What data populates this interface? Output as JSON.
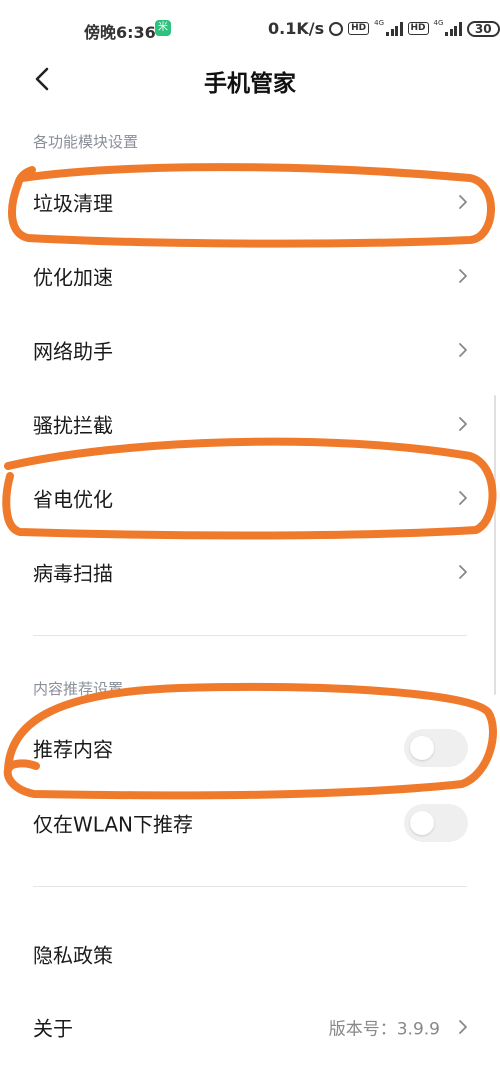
{
  "status_bar": {
    "time": "傍晚6:36",
    "msg_icon": "米",
    "speed": "0.1K/s",
    "hd1": "HD",
    "hd2": "HD",
    "net1": "4G",
    "net2": "4G",
    "battery": "30"
  },
  "header": {
    "title": "手机管家"
  },
  "section1": {
    "label": "各功能模块设置"
  },
  "rows": [
    {
      "label": "垃圾清理"
    },
    {
      "label": "优化加速"
    },
    {
      "label": "网络助手"
    },
    {
      "label": "骚扰拦截"
    },
    {
      "label": "省电优化"
    },
    {
      "label": "病毒扫描"
    }
  ],
  "section2": {
    "label": "内容推荐设置"
  },
  "toggles": [
    {
      "label": "推荐内容",
      "enabled": false
    },
    {
      "label": "仅在WLAN下推荐",
      "enabled": false
    }
  ],
  "footer_rows": [
    {
      "label": "隐私政策"
    },
    {
      "label": "关于",
      "value": "版本号：3.9.9"
    }
  ],
  "annotation_color": "#F07A2C"
}
